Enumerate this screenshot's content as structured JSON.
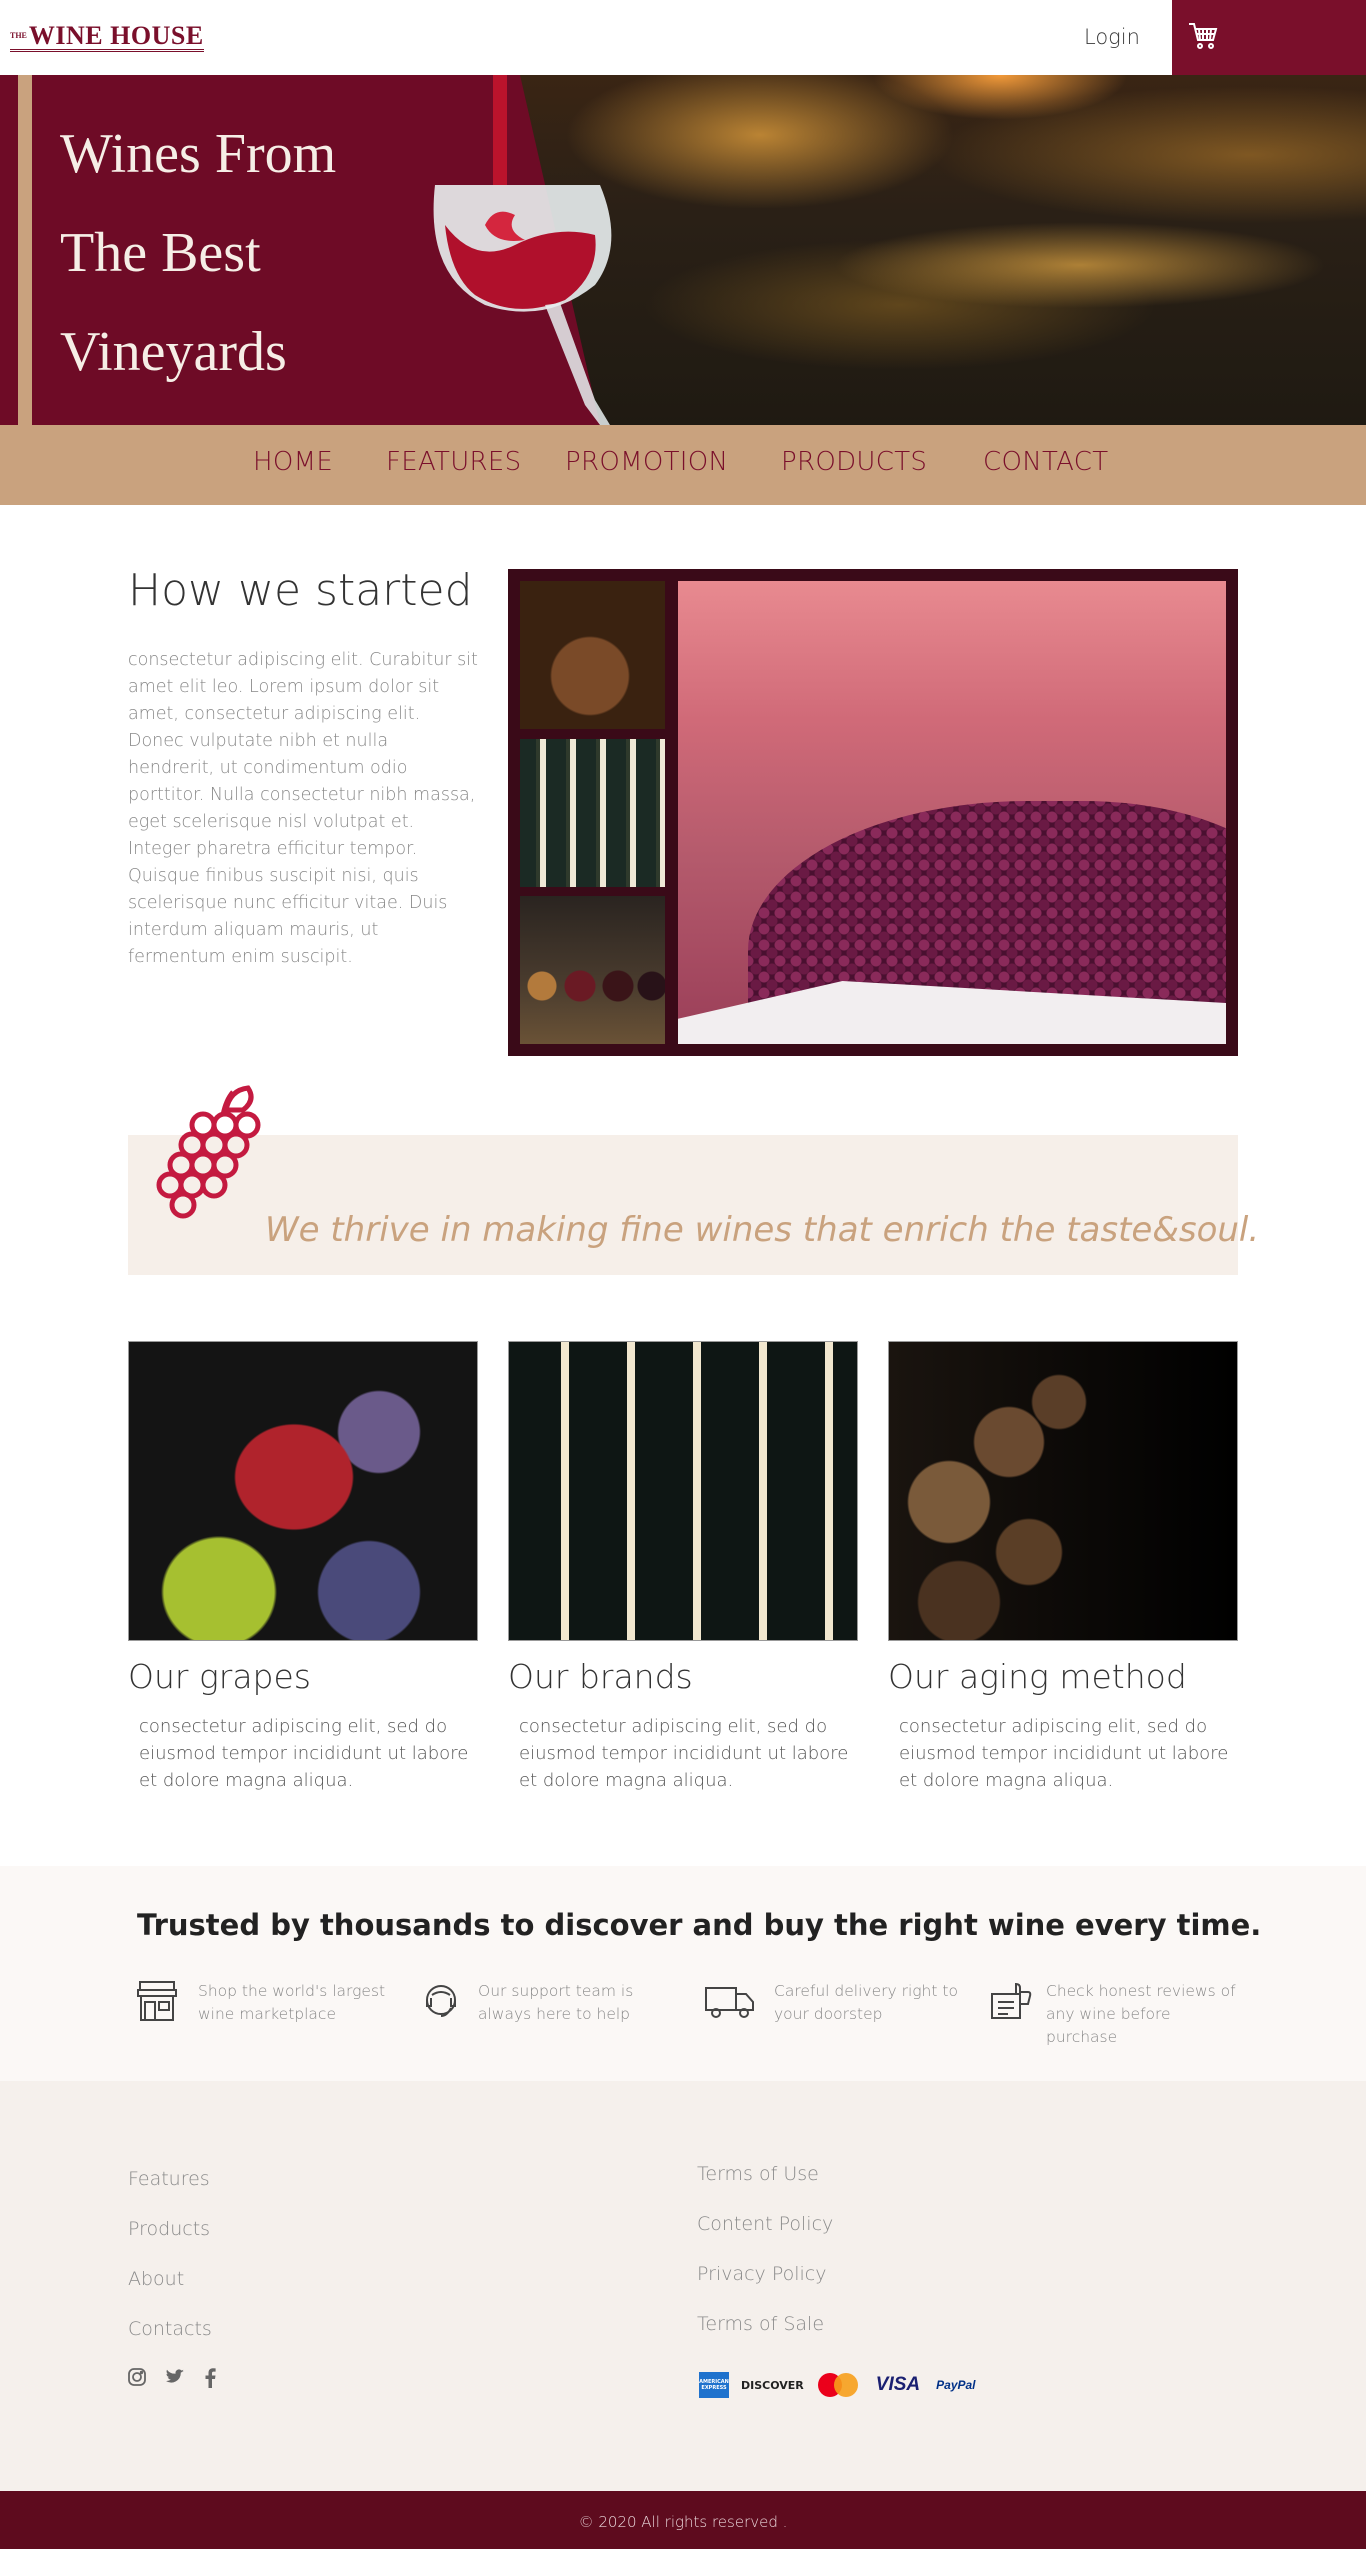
{
  "header": {
    "logo_small": "THE",
    "logo_text": "WINE HOUSE",
    "login_label": "Login",
    "cart_icon": "cart-icon"
  },
  "hero": {
    "title_line1": "Wines From",
    "title_line2": "The Best",
    "title_line3": "Vineyards"
  },
  "nav": {
    "items": [
      {
        "label": "HOME"
      },
      {
        "label": "FEATURES"
      },
      {
        "label": "PROMOTION"
      },
      {
        "label": "PRODUCTS"
      },
      {
        "label": "CONTACT"
      }
    ]
  },
  "about": {
    "title": "How we started",
    "text": "consectetur adipiscing elit. Curabitur sit amet elit leo. Lorem ipsum dolor sit amet, consectetur adipiscing elit. Donec vulputate nibh et nulla hendrerit, ut condimentum odio porttitor. Nulla consectetur nibh massa, eget scelerisque nisl volutpat et. Integer pharetra efficitur tempor. Quisque finibus suscipit nisi, quis scelerisque nunc efficitur vitae. Duis interdum aliquam mauris, ut fermentum enim suscipit."
  },
  "quote": {
    "text": "We thrive in making fine wines that enrich the taste&soul."
  },
  "cards": [
    {
      "title": "Our grapes",
      "text": "consectetur adipiscing elit, sed do eiusmod tempor incididunt ut labore et dolore magna aliqua."
    },
    {
      "title": "Our brands",
      "text": "consectetur adipiscing elit, sed do eiusmod tempor incididunt ut labore et dolore magna aliqua."
    },
    {
      "title": "Our aging method",
      "text": "consectetur adipiscing elit, sed do eiusmod tempor incididunt ut labore et dolore magna aliqua."
    }
  ],
  "trusted": {
    "title": "Trusted by thousands to discover and buy the right wine every time.",
    "features": [
      {
        "icon": "store-icon",
        "text": "Shop the world's largest wine marketplace"
      },
      {
        "icon": "support-headset-icon",
        "text": "Our support team is always here to help"
      },
      {
        "icon": "delivery-truck-icon",
        "text": "Careful delivery right to your doorstep"
      },
      {
        "icon": "review-thumbs-up-icon",
        "text": "Check honest reviews of any wine before purchase"
      }
    ]
  },
  "footer": {
    "left_links": [
      {
        "label": "Features"
      },
      {
        "label": "Products"
      },
      {
        "label": "About"
      },
      {
        "label": "Contacts"
      }
    ],
    "right_links": [
      {
        "label": "Terms of Use"
      },
      {
        "label": "Content Policy"
      },
      {
        "label": "Privacy Policy"
      },
      {
        "label": "Terms of Sale"
      }
    ],
    "social": [
      "instagram-icon",
      "twitter-icon",
      "facebook-icon"
    ],
    "payments": {
      "amex": "AMERICAN EXPRESS",
      "discover": "DISCOVER",
      "visa": "VISA",
      "paypal": "PayPal"
    },
    "copyright": "© 2020 All rights reserved ."
  },
  "colors": {
    "wine": "#7a0f2b",
    "tan": "#c9a27e",
    "cream": "#f6efe9",
    "footer_dark": "#5e0b1e"
  }
}
